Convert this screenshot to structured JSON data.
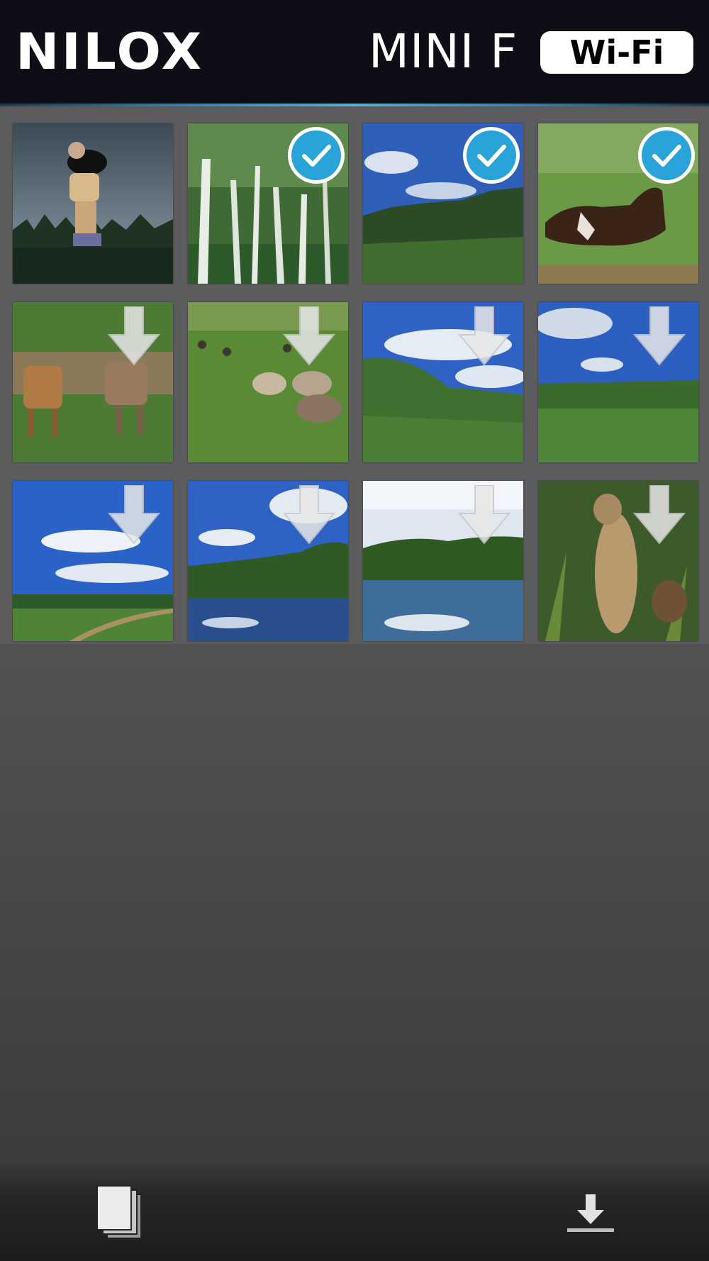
{
  "header": {
    "brand": "NILOX",
    "model": "MINI F",
    "badge": "Wi-Fi"
  },
  "gallery": {
    "thumbnails": [
      {
        "scene": "snowboarder",
        "state": "none"
      },
      {
        "scene": "birch-forest",
        "state": "selected"
      },
      {
        "scene": "hills-sky",
        "state": "selected"
      },
      {
        "scene": "cow-lying",
        "state": "selected"
      },
      {
        "scene": "cattle-field",
        "state": "download"
      },
      {
        "scene": "sheep-grazing",
        "state": "download"
      },
      {
        "scene": "hillside-clouds",
        "state": "download"
      },
      {
        "scene": "plain-clouds",
        "state": "download"
      },
      {
        "scene": "meadow-path",
        "state": "download"
      },
      {
        "scene": "lake-trees",
        "state": "download"
      },
      {
        "scene": "pond-reflection",
        "state": "download"
      },
      {
        "scene": "prairie-dog",
        "state": "download"
      }
    ]
  },
  "toolbar": {
    "left_icon": "stack-icon",
    "right_icon": "download-icon"
  },
  "colors": {
    "header_bg": "#0d0e16",
    "check_blue": "#29a3d8",
    "content_bg": "#5b5b5d"
  }
}
